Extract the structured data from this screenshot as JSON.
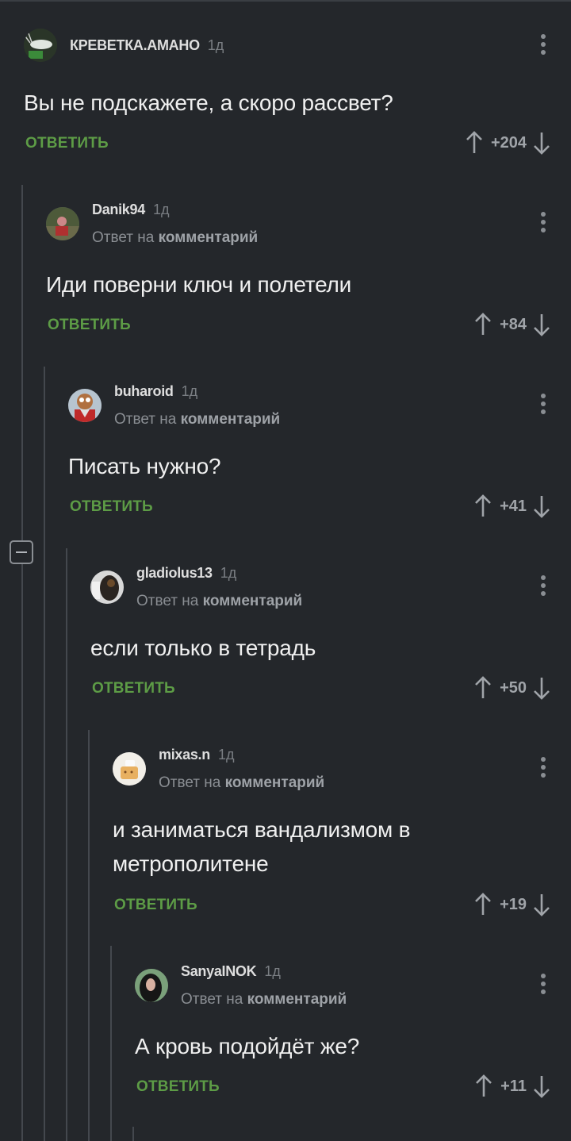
{
  "comments": [
    {
      "username": "КРЕВЕТКА.АМАНО",
      "time": "1д",
      "reply_prefix": "",
      "reply_link": "",
      "text": "Вы не подскажете, а скоро рассвет?",
      "reply_label": "ОТВЕТИТЬ",
      "score": "+204"
    },
    {
      "username": "Danik94",
      "time": "1д",
      "reply_prefix": "Ответ на",
      "reply_link": "комментарий",
      "text": "Иди поверни ключ и полетели",
      "reply_label": "ОТВЕТИТЬ",
      "score": "+84"
    },
    {
      "username": "buharoid",
      "time": "1д",
      "reply_prefix": "Ответ на",
      "reply_link": "комментарий",
      "text": "Писать нужно?",
      "reply_label": "ОТВЕТИТЬ",
      "score": "+41"
    },
    {
      "username": "gladiolus13",
      "time": "1д",
      "reply_prefix": "Ответ на",
      "reply_link": "комментарий",
      "text": "если только в тетрадь",
      "reply_label": "ОТВЕТИТЬ",
      "score": "+50"
    },
    {
      "username": "mixas.n",
      "time": "1д",
      "reply_prefix": "Ответ на",
      "reply_link": "комментарий",
      "text": "и заниматься вандализмом в метрополитене",
      "reply_label": "ОТВЕТИТЬ",
      "score": "+19"
    },
    {
      "username": "SanyaINOK",
      "time": "1д",
      "reply_prefix": "Ответ на",
      "reply_link": "комментарий",
      "text": "А кровь подойдёт же?",
      "reply_label": "ОТВЕТИТЬ",
      "score": "+11"
    }
  ],
  "colors": {
    "background": "#24272b",
    "reply_green": "#5d9c46",
    "thread_line": "#44484e"
  }
}
